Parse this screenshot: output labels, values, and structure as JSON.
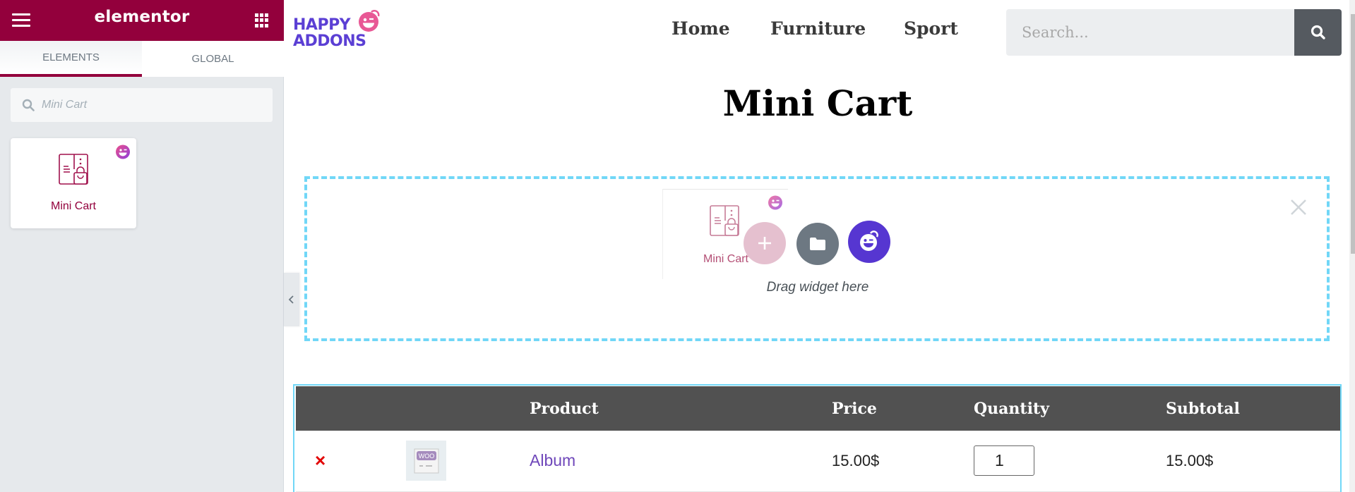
{
  "editor": {
    "brand": "elementor",
    "tabs": [
      {
        "label": "ELEMENTS",
        "active": true
      },
      {
        "label": "GLOBAL",
        "active": false
      }
    ],
    "search": {
      "value": "",
      "placeholder": "Mini Cart"
    },
    "widgets": [
      {
        "label": "Mini Cart",
        "icon": "mini-cart-icon",
        "badge": "happy-addons-badge"
      }
    ],
    "accent_color": "#93003c"
  },
  "site": {
    "logo": {
      "line1": "HAPPY",
      "line2": "ADDONS"
    },
    "nav": [
      {
        "label": "Home"
      },
      {
        "label": "Furniture"
      },
      {
        "label": "Sport"
      }
    ],
    "search": {
      "placeholder": "Search...",
      "value": ""
    },
    "page_title": "Mini Cart"
  },
  "dropzone": {
    "hint": "Drag widget here",
    "dragging_widget": "Mini Cart",
    "buttons": [
      "add-section",
      "add-template",
      "happy-addons-templates"
    ]
  },
  "cart": {
    "headers": [
      "",
      "",
      "Product",
      "Price",
      "Quantity",
      "Subtotal"
    ],
    "rows": [
      {
        "remove": "×",
        "thumbnail": "woo-placeholder",
        "product": "Album",
        "price": "15.00$",
        "quantity": "1",
        "subtotal": "15.00$"
      }
    ]
  }
}
